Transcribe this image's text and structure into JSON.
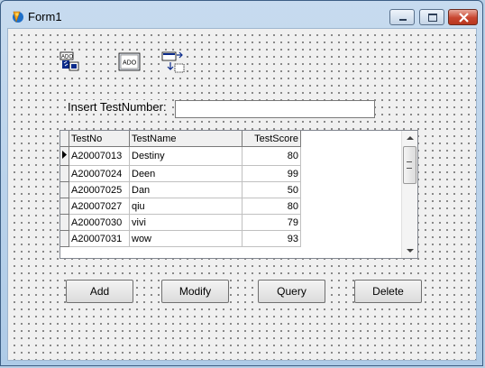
{
  "window": {
    "title": "Form1"
  },
  "components": [
    {
      "icon": "ado-connection-icon"
    },
    {
      "icon": "ado-table-icon"
    },
    {
      "icon": "datasource-icon"
    }
  ],
  "form": {
    "label": "Insert TestNumber:",
    "input_value": ""
  },
  "grid": {
    "columns": [
      "TestNo",
      "TestName",
      "TestScore"
    ],
    "rows": [
      [
        "A20007013",
        "Destiny",
        "80"
      ],
      [
        "A20007024",
        "Deen",
        "99"
      ],
      [
        "A20007025",
        "Dan",
        "50"
      ],
      [
        "A20007027",
        "qiu",
        "80"
      ],
      [
        "A20007030",
        "vivi",
        "79"
      ],
      [
        "A20007031",
        "wow",
        "93"
      ]
    ],
    "selected_row": 0
  },
  "buttons": {
    "add": "Add",
    "modify": "Modify",
    "query": "Query",
    "delete": "Delete"
  }
}
